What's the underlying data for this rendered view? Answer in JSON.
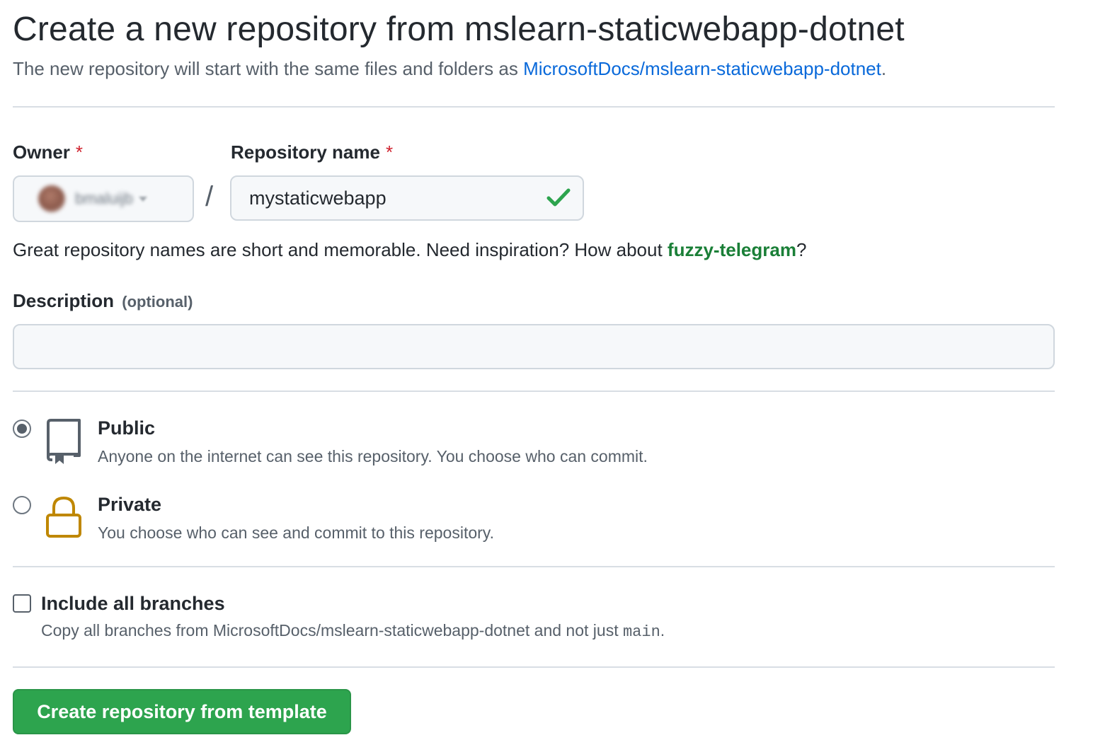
{
  "header": {
    "title": "Create a new repository from mslearn-staticwebapp-dotnet",
    "subtitle_prefix": "The new repository will start with the same files and folders as ",
    "template_link": "MicrosoftDocs/mslearn-staticwebapp-dotnet",
    "subtitle_suffix": "."
  },
  "owner": {
    "label": "Owner",
    "required_mark": "*",
    "selected_value": "bmaluijb"
  },
  "separator": "/",
  "repo_name": {
    "label": "Repository name",
    "required_mark": "*",
    "value": "mystaticwebapp",
    "valid": true
  },
  "name_hint": {
    "text": "Great repository names are short and memorable. Need inspiration? How about ",
    "suggestion": "fuzzy-telegram",
    "suffix": "?"
  },
  "description": {
    "label": "Description",
    "optional_label": "(optional)",
    "value": ""
  },
  "visibility": {
    "options": [
      {
        "title": "Public",
        "description": "Anyone on the internet can see this repository. You choose who can commit.",
        "icon": "repo-icon",
        "selected": true
      },
      {
        "title": "Private",
        "description": "You choose who can see and commit to this repository.",
        "icon": "lock-icon",
        "selected": false
      }
    ]
  },
  "include_branches": {
    "label": "Include all branches",
    "desc_prefix": "Copy all branches from MicrosoftDocs/mslearn-staticwebapp-dotnet and not just ",
    "branch": "main",
    "desc_suffix": ".",
    "checked": false
  },
  "submit": {
    "label": "Create repository from template"
  },
  "colors": {
    "link": "#0969da",
    "success": "#1a7f37",
    "button": "#2da44e",
    "required": "#cf222e",
    "lock": "#bf8700"
  }
}
